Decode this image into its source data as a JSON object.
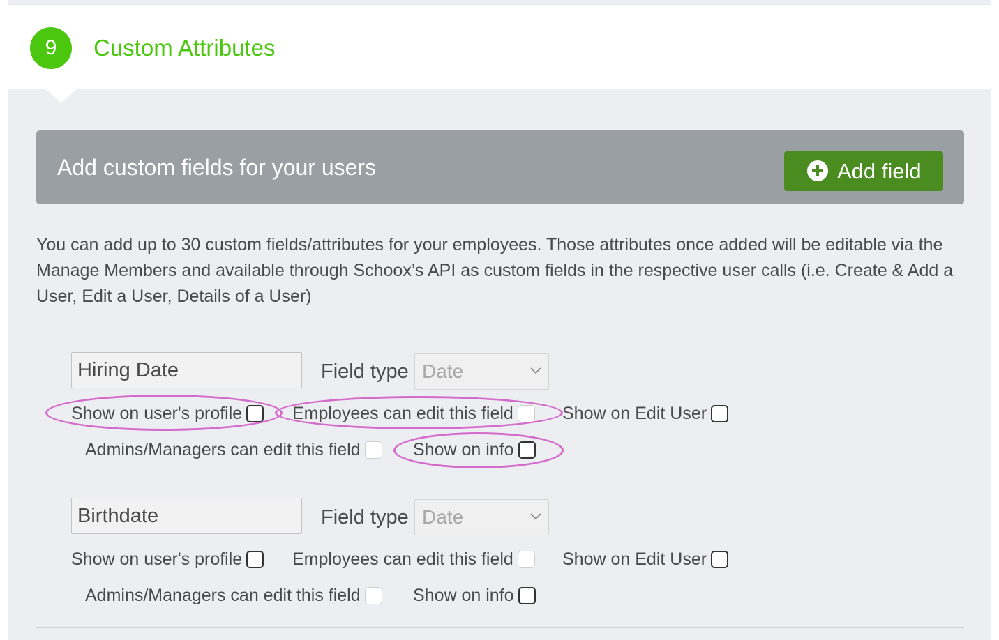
{
  "section": {
    "step_number": "9",
    "title": "Custom Attributes"
  },
  "banner": {
    "title": "Add custom fields for your users",
    "add_button_label": "Add field"
  },
  "description": "You can add up to 30 custom fields/attributes for your employees. Those attributes once added will be editable via the Manage Members and available through Schoox’s API as custom fields in the respective user calls (i.e. Create & Add a User, Edit a User, Details of a User)",
  "fields": [
    {
      "name": "Hiring Date",
      "field_type_label": "Field type",
      "field_type_value": "Date",
      "options": {
        "show_on_profile": "Show on user's profile",
        "employees_can_edit": "Employees can edit this field",
        "show_on_edit_user": "Show on Edit User",
        "admins_can_edit": "Admins/Managers can edit this field",
        "show_on_info": "Show on info"
      }
    },
    {
      "name": "Birthdate",
      "field_type_label": "Field type",
      "field_type_value": "Date",
      "options": {
        "show_on_profile": "Show on user's profile",
        "employees_can_edit": "Employees can edit this field",
        "show_on_edit_user": "Show on Edit User",
        "admins_can_edit": "Admins/Managers can edit this field",
        "show_on_info": "Show on info"
      }
    }
  ],
  "colors": {
    "accent_green": "#4bc70f",
    "button_green": "#4a8c1f",
    "banner_gray": "#9a9fa3",
    "annotation_pink": "#d46ccb"
  }
}
